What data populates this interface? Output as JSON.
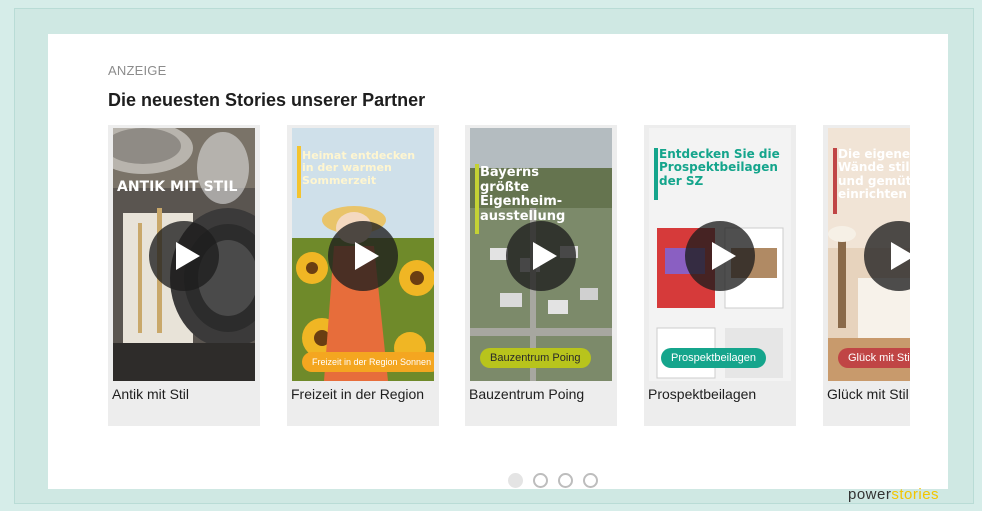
{
  "ad_label": "ANZEIGE",
  "headline": "Die neuesten Stories unserer Partner",
  "stories": [
    {
      "caption": "Antik mit Stil",
      "overlay": "ANTIK MIT STIL",
      "pill": ""
    },
    {
      "caption": "Freizeit in der Region",
      "overlay": "Heimat entdecken in der warmen Sommerzeit",
      "pill": "Freizeit in der Region Sonnen",
      "accent": "#f4c430"
    },
    {
      "caption": "Bauzentrum Poing",
      "overlay": "Bayerns größte Eigenheim-ausstellung",
      "pill": "Bauzentrum Poing",
      "accent": "#c4d234"
    },
    {
      "caption": "Prospektbeilagen",
      "overlay": "Entdecken Sie die Prospektbeilagen der SZ",
      "pill": "Prospektbeilagen",
      "accent": "#15a58c"
    },
    {
      "caption": "Glück mit Stil",
      "overlay": "Die eigenen Wände stil- und gemütlich einrichten",
      "pill": "Glück mit Stil",
      "accent": "#c04545"
    }
  ],
  "pagination": {
    "count": 4,
    "active": 0
  },
  "brand": {
    "part1": "power",
    "part2": "stories",
    "accent": "#f2c500"
  }
}
